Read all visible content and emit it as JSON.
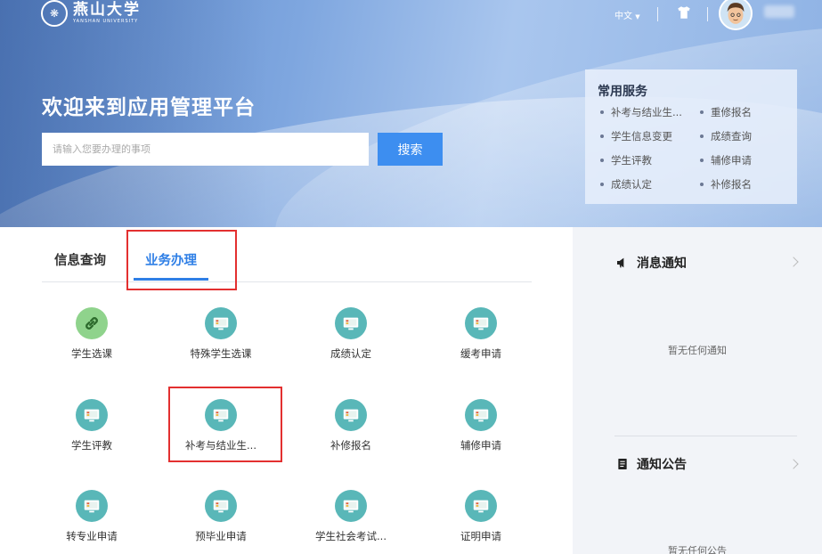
{
  "header": {
    "logo": {
      "cn": "燕山大学",
      "en": "YANSHAN UNIVERSITY"
    },
    "language": "中文",
    "welcome": "欢迎来到应用管理平台"
  },
  "search": {
    "placeholder": "请输入您要办理的事项",
    "button": "搜索"
  },
  "common_services": {
    "title": "常用服务",
    "items": [
      "补考与结业生...",
      "重修报名",
      "学生信息变更",
      "成绩查询",
      "学生评教",
      "辅修申请",
      "成绩认定",
      "补修报名"
    ]
  },
  "tabs": [
    {
      "label": "信息查询",
      "active": false
    },
    {
      "label": "业务办理",
      "active": true
    }
  ],
  "apps": [
    {
      "label": "学生选课",
      "icon": "link-icon"
    },
    {
      "label": "特殊学生选课",
      "icon": "monitor-icon"
    },
    {
      "label": "成绩认定",
      "icon": "monitor-icon"
    },
    {
      "label": "缓考申请",
      "icon": "monitor-icon"
    },
    {
      "label": "学生评教",
      "icon": "monitor-icon"
    },
    {
      "label": "补考与结业生...",
      "icon": "monitor-icon"
    },
    {
      "label": "补修报名",
      "icon": "monitor-icon"
    },
    {
      "label": "辅修申请",
      "icon": "monitor-icon"
    },
    {
      "label": "转专业申请",
      "icon": "monitor-icon"
    },
    {
      "label": "预毕业申请",
      "icon": "monitor-icon"
    },
    {
      "label": "学生社会考试...",
      "icon": "monitor-icon"
    },
    {
      "label": "证明申请",
      "icon": "monitor-icon"
    }
  ],
  "notices": {
    "message_title": "消息通知",
    "message_empty": "暂无任何通知",
    "announcement_title": "通知公告",
    "announcement_empty": "暂无任何公告"
  },
  "colors": {
    "accent": "#2f7fe6",
    "highlight": "#e33030",
    "icon_teal": "#59b7b8",
    "icon_green": "#8fd38c"
  }
}
